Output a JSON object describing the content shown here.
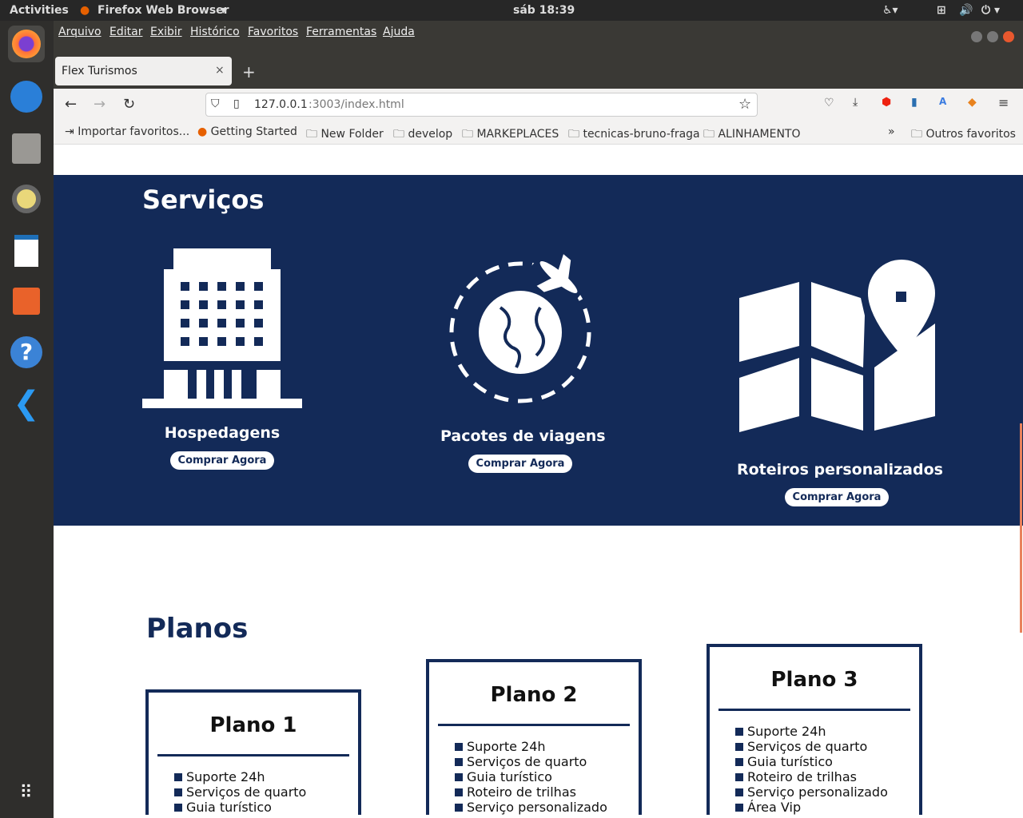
{
  "system": {
    "activities": "Activities",
    "app": "Firefox Web Browser",
    "clock": "sáb 18:39"
  },
  "menu": [
    "Arquivo",
    "Editar",
    "Exibir",
    "Histórico",
    "Favoritos",
    "Ferramentas",
    "Ajuda"
  ],
  "tab": {
    "title": "Flex Turismos"
  },
  "url": {
    "host": "127.0.0.1",
    "rest": ":3003/index.html"
  },
  "bookmarks": [
    "Importar favoritos...",
    "Getting Started",
    "New Folder",
    "develop",
    "MARKEPLACES",
    "tecnicas-bruno-fraga",
    "ALINHAMENTO"
  ],
  "other_bookmarks": "Outros favoritos",
  "services": {
    "title": "Serviços",
    "items": [
      {
        "name": "Hospedagens",
        "button": "Comprar Agora"
      },
      {
        "name": "Pacotes de viagens",
        "button": "Comprar Agora"
      },
      {
        "name": "Roteiros personalizados",
        "button": "Comprar Agora"
      }
    ]
  },
  "plans": {
    "title": "Planos",
    "cards": [
      {
        "name": "Plano 1",
        "features": [
          "Suporte 24h",
          "Serviços de quarto",
          "Guia turístico"
        ]
      },
      {
        "name": "Plano 2",
        "features": [
          "Suporte 24h",
          "Serviços de quarto",
          "Guia turístico",
          "Roteiro de trilhas",
          "Serviço personalizado"
        ]
      },
      {
        "name": "Plano 3",
        "features": [
          "Suporte 24h",
          "Serviços de quarto",
          "Guia turístico",
          "Roteiro de trilhas",
          "Serviço personalizado",
          "Área Vip"
        ]
      }
    ]
  }
}
